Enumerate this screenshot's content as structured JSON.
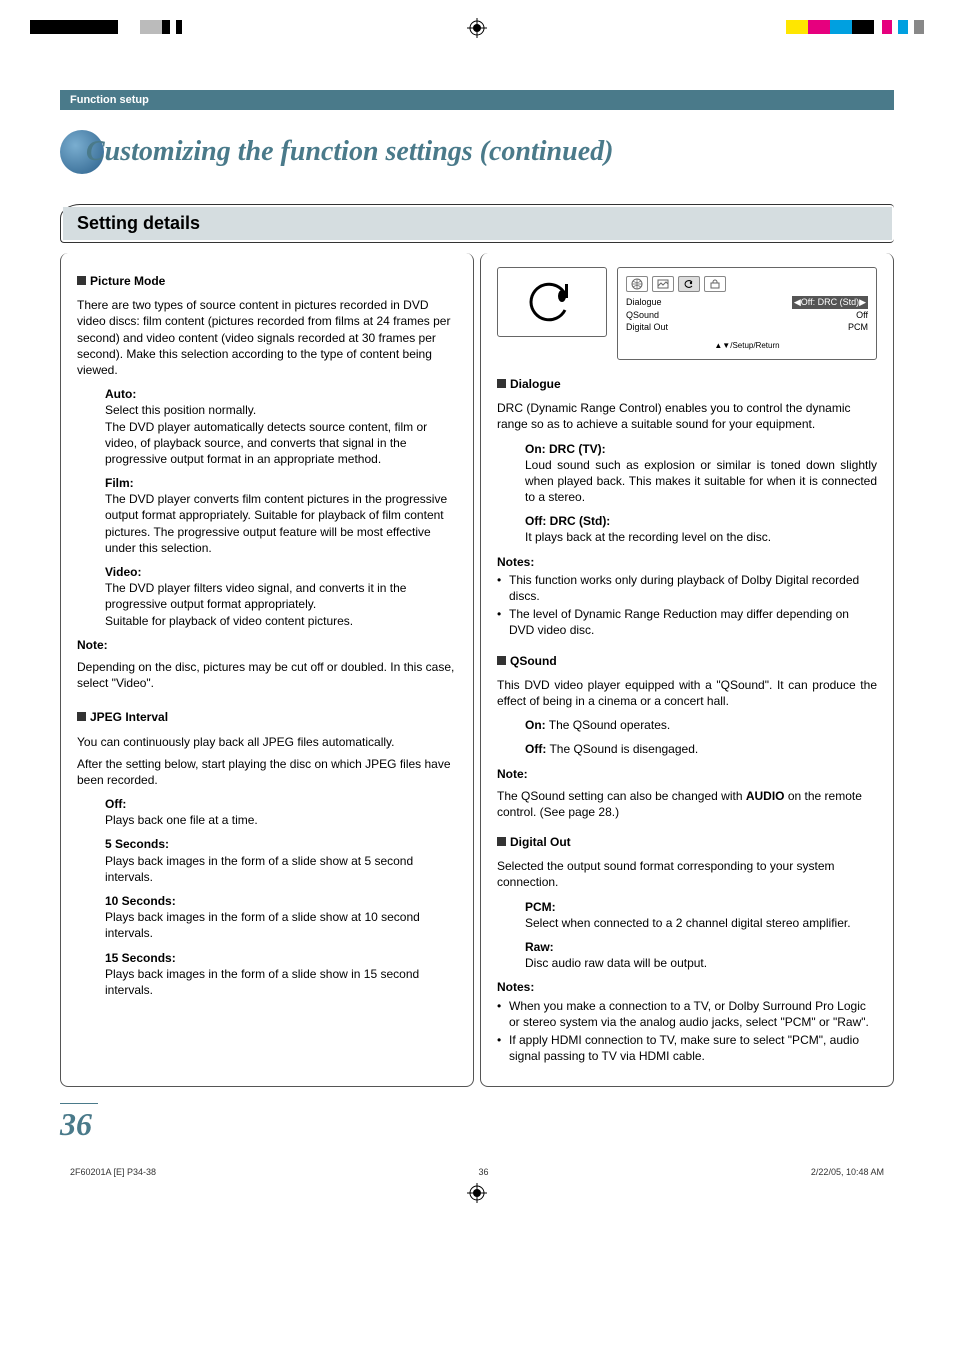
{
  "printer": {
    "left_bars": [
      "#000",
      "#000",
      "#000",
      "#000",
      "#fff",
      "#bbb",
      "#000",
      "#fff",
      "#000",
      "#fff"
    ],
    "right_bars": [
      "#ffe600",
      "#e6007e",
      "#00a0e0",
      "#000",
      "#fff",
      "#e6007e",
      "#fff",
      "#00a0e0",
      "#fff",
      "#888",
      "#fff"
    ]
  },
  "header": {
    "section": "Function setup",
    "title": "Customizing the function settings (continued)"
  },
  "setting_bar": "Setting details",
  "left_col": {
    "picture_mode": {
      "heading": "Picture Mode",
      "intro": "There are two types of source content in pictures recorded in DVD video discs: film content (pictures recorded from films at 24 frames per second) and video content (video signals recorded at 30 frames per second). Make this selection according to the type of content being viewed.",
      "auto_t": "Auto:",
      "auto_b1": "Select this position normally.",
      "auto_b2": "The DVD player automatically detects source content, film or video, of playback source, and converts that signal in the progressive output format in an appropriate method.",
      "film_t": "Film:",
      "film_b": "The DVD player converts film content pictures in the progressive output format appropriately. Suitable for playback of film content pictures. The progressive output feature will be most effective under this selection.",
      "video_t": "Video:",
      "video_b1": "The DVD player filters video signal, and converts it in the progressive output format appropriately.",
      "video_b2": "Suitable for playback of video content pictures.",
      "note_t": "Note:",
      "note_b": "Depending on the disc, pictures may be cut off or doubled. In this case, select \"Video\"."
    },
    "jpeg": {
      "heading": "JPEG Interval",
      "intro1": "You can continuously play back all JPEG files automatically.",
      "intro2": "After the setting below, start playing the disc on which JPEG files have been recorded.",
      "off_t": "Off:",
      "off_b": "Plays back one file at a time.",
      "s5_t": "5 Seconds:",
      "s5_b": "Plays back images in the form of a slide show at 5 second intervals.",
      "s10_t": "10 Seconds:",
      "s10_b": "Plays back images in the form of a slide show at 10 second intervals.",
      "s15_t": "15 Seconds:",
      "s15_b": "Plays back images in the form of a slide show in 15 second intervals."
    }
  },
  "right_col": {
    "preview": {
      "rows": [
        {
          "l": "Dialogue",
          "r": "◀Off: DRC (Std)▶",
          "hl": true
        },
        {
          "l": "QSound",
          "r": "Off"
        },
        {
          "l": "Digital Out",
          "r": "PCM"
        }
      ],
      "footer": "▲▼/Setup/Return"
    },
    "dialogue": {
      "heading": "Dialogue",
      "intro": "DRC (Dynamic Range Control) enables you to control the dynamic range so as to achieve a suitable sound for your equipment.",
      "on_t": "On: DRC (TV):",
      "on_b": "Loud sound such as explosion or similar is toned down slightly when played back. This makes it suitable for when it is connected to a stereo.",
      "off_t": "Off: DRC (Std):",
      "off_b": "It plays back at the recording level on the disc.",
      "notes_t": "Notes:",
      "notes": [
        "This function works only during playback of Dolby Digital recorded discs.",
        "The level of Dynamic Range Reduction may differ depending on DVD video disc."
      ]
    },
    "qsound": {
      "heading": "QSound",
      "intro": "This DVD video player equipped with a \"QSound\". It can produce the effect of being in a cinema or a concert hall.",
      "on_t": "On:",
      "on_b": " The QSound operates.",
      "off_t": "Off:",
      "off_b": " The QSound is disengaged.",
      "note_t": "Note:",
      "note_b1": "The QSound setting can also be changed with ",
      "note_bold": "AUDIO",
      "note_b2": " on the remote control. (See page 28.)"
    },
    "digital": {
      "heading": "Digital Out",
      "intro": "Selected the output sound format corresponding to your system connection.",
      "pcm_t": "PCM:",
      "pcm_b": "Select when connected to a 2 channel digital stereo amplifier.",
      "raw_t": "Raw:",
      "raw_b": "Disc audio raw data will be output.",
      "notes_t": "Notes:",
      "notes": [
        "When you make a connection to a TV, or Dolby Surround Pro Logic or stereo system via the analog audio jacks, select \"PCM\" or \"Raw\".",
        "If apply HDMI connection to TV, make sure to select \"PCM\", audio signal passing to TV via HDMI cable."
      ]
    }
  },
  "page_number": "36",
  "footer": {
    "left": "2F60201A [E] P34-38",
    "center": "36",
    "right": "2/22/05, 10:48 AM"
  }
}
